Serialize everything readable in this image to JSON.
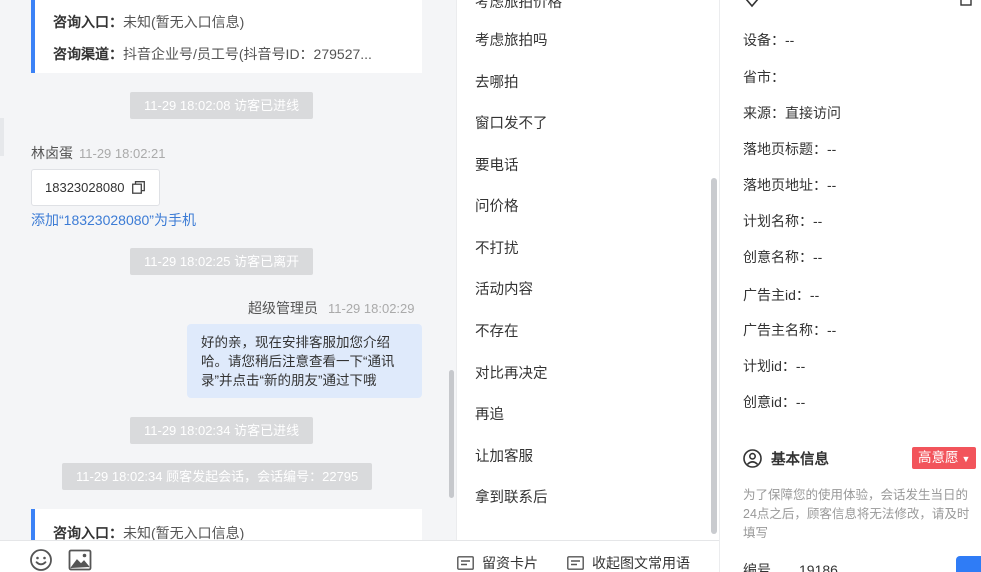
{
  "chat": {
    "cards": [
      {
        "entry_label": "咨询入口：",
        "entry_value": "未知(暂无入口信息)",
        "channel_label": "咨询渠道：",
        "channel_value": "抖音企业号/员工号(抖音号ID：279527..."
      },
      {
        "entry_label": "咨询入口：",
        "entry_value": "未知(暂无入口信息)"
      }
    ],
    "system_messages": [
      "11-29 18:02:08 访客已进线",
      "11-29 18:02:25 访客已离开",
      "11-29 18:02:34 访客已进线",
      "11-29 18:02:34 顾客发起会话，会话编号：22795"
    ],
    "visitor": {
      "name": "林卤蛋",
      "time": "11-29 18:02:21",
      "phone": "18323028080",
      "add_link": "添加“18323028080”为手机"
    },
    "agent": {
      "name": "超级管理员",
      "time": "11-29 18:02:29",
      "lines": [
        "好的亲，现在安排客服加您介绍",
        "哈。请您稍后注意查看一下“通讯",
        "录”并点击“新的朋友”通过下哦"
      ]
    }
  },
  "toolbar": {
    "lead_card_label": "留资卡片",
    "collapse_label": "收起图文常用语"
  },
  "phrases": [
    "考虑旅拍吗",
    "去哪拍",
    "窗口发不了",
    "要电话",
    "问价格",
    "不打扰",
    "活动内容",
    "不存在",
    "对比再决定",
    "再追",
    "让加客服",
    "拿到联系后"
  ],
  "source": {
    "fields": [
      {
        "label": "设备：",
        "value": "--"
      },
      {
        "label": "省市：",
        "value": ""
      },
      {
        "label": "来源：",
        "value": "直接访问"
      },
      {
        "label": "落地页标题：",
        "value": "--"
      },
      {
        "label": "落地页地址：",
        "value": "--"
      },
      {
        "label": "计划名称：",
        "value": "--"
      },
      {
        "label": "创意名称：",
        "value": "--"
      },
      {
        "label": "广告主id：",
        "value": "--"
      },
      {
        "label": "广告主名称：",
        "value": "--"
      },
      {
        "label": "计划id：",
        "value": "--"
      },
      {
        "label": "创意id：",
        "value": "--"
      }
    ]
  },
  "basic": {
    "title": "基本信息",
    "badge": "高意愿",
    "notice": "为了保障您的使用体验，会话发生当日的24点之后，顾客信息将无法修改，请及时填写",
    "id_label": "编号",
    "id_value": "19186"
  },
  "colors": {
    "accent": "#3b82f6",
    "badge": "#f2545b",
    "link": "#3b7bd5",
    "bubble": "#dfeafb"
  }
}
